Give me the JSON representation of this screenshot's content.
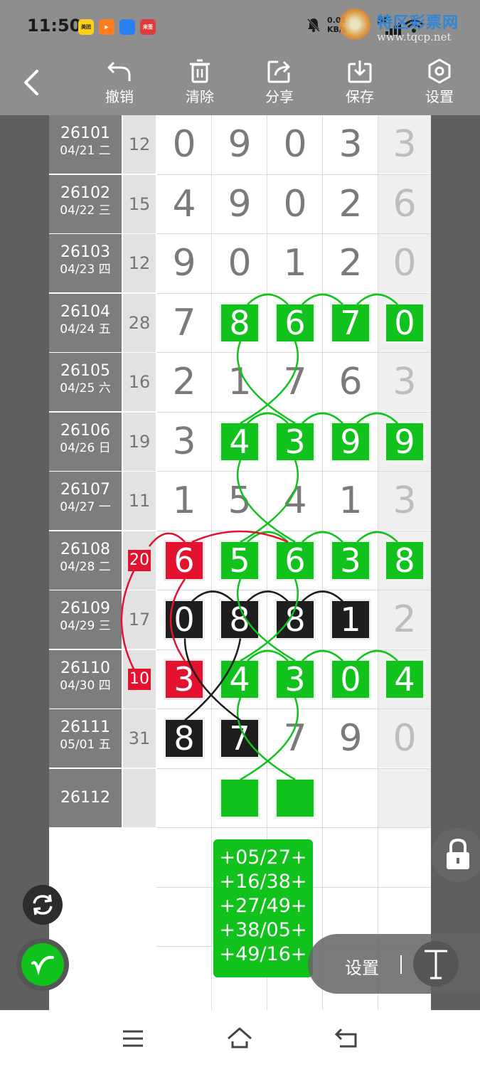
{
  "status_bar": {
    "time": "11:50",
    "app_icons": [
      {
        "label": "美团",
        "color": "#ffcf1a",
        "text_color": "#222222"
      },
      {
        "label": "▶",
        "color": "#ff7d22",
        "text_color": "#ffffff"
      },
      {
        "label": "",
        "color": "#2a80f0",
        "text_color": "#ffffff"
      },
      {
        "label": "来签",
        "color": "#e23b3b",
        "text_color": "#ffffff"
      }
    ],
    "net_speed_value": "0.01",
    "net_speed_unit": "KB/s",
    "signal_label": "5G",
    "watermark_title": "特区彩票网",
    "watermark_url": "www.tqcp.net"
  },
  "toolbar": {
    "undo": "撤销",
    "clear": "清除",
    "share": "分享",
    "save": "保存",
    "settings": "设置"
  },
  "rows": [
    {
      "issue": "26101",
      "date": "04/21 二",
      "sum": "12",
      "digits": [
        "0",
        "9",
        "0",
        "3",
        "3"
      ]
    },
    {
      "issue": "26102",
      "date": "04/22 三",
      "sum": "15",
      "digits": [
        "4",
        "9",
        "0",
        "2",
        "6"
      ]
    },
    {
      "issue": "26103",
      "date": "04/23 四",
      "sum": "12",
      "digits": [
        "9",
        "0",
        "1",
        "2",
        "0"
      ]
    },
    {
      "issue": "26104",
      "date": "04/24 五",
      "sum": "28",
      "digits": [
        "7",
        "8",
        "6",
        "7",
        "0"
      ]
    },
    {
      "issue": "26105",
      "date": "04/25 六",
      "sum": "16",
      "digits": [
        "2",
        "1",
        "7",
        "6",
        "3"
      ]
    },
    {
      "issue": "26106",
      "date": "04/26 日",
      "sum": "19",
      "digits": [
        "3",
        "4",
        "3",
        "9",
        "9"
      ]
    },
    {
      "issue": "26107",
      "date": "04/27 一",
      "sum": "11",
      "digits": [
        "1",
        "5",
        "4",
        "1",
        "3"
      ]
    },
    {
      "issue": "26108",
      "date": "04/28 二",
      "sum": "20",
      "digits": [
        "6",
        "5",
        "6",
        "3",
        "8"
      ]
    },
    {
      "issue": "26109",
      "date": "04/29 三",
      "sum": "17",
      "digits": [
        "0",
        "8",
        "8",
        "1",
        "2"
      ]
    },
    {
      "issue": "26110",
      "date": "04/30 四",
      "sum": "10",
      "digits": [
        "3",
        "4",
        "3",
        "0",
        "4"
      ]
    },
    {
      "issue": "26111",
      "date": "05/01 五",
      "sum": "31",
      "digits": [
        "8",
        "7",
        "7",
        "9",
        "0"
      ]
    },
    {
      "issue": "26112",
      "date": "",
      "sum": "",
      "digits": [
        "",
        "",
        "",
        "",
        ""
      ]
    }
  ],
  "highlights": {
    "green": [
      [
        3,
        1
      ],
      [
        3,
        2
      ],
      [
        3,
        3
      ],
      [
        3,
        4
      ],
      [
        5,
        1
      ],
      [
        5,
        2
      ],
      [
        5,
        3
      ],
      [
        5,
        4
      ],
      [
        7,
        1
      ],
      [
        7,
        2
      ],
      [
        7,
        3
      ],
      [
        7,
        4
      ],
      [
        9,
        1
      ],
      [
        9,
        2
      ],
      [
        9,
        3
      ],
      [
        9,
        4
      ],
      [
        11,
        1
      ],
      [
        11,
        2
      ]
    ],
    "black": [
      [
        8,
        0
      ],
      [
        8,
        1
      ],
      [
        8,
        2
      ],
      [
        8,
        3
      ],
      [
        10,
        0
      ],
      [
        10,
        1
      ]
    ],
    "red": [
      [
        7,
        0
      ],
      [
        9,
        0
      ]
    ],
    "red_sum_rows": [
      7,
      9
    ]
  },
  "colors": {
    "green": "#12c21c",
    "black": "#1e1e1e",
    "red": "#e3122e"
  },
  "prediction_lines": [
    "+05/27+",
    "+16/38+",
    "+27/49+",
    "+38/05+",
    "+49/16+"
  ],
  "float_panel": {
    "settings_label": "设置"
  },
  "icons": {
    "back": "chevron-left-icon",
    "undo": "undo-icon",
    "clear": "trash-icon",
    "share": "share-icon",
    "save": "download-icon",
    "settings": "gear-icon",
    "lock": "lock-icon",
    "refresh": "refresh-icon",
    "pen": "pen-icon",
    "text": "text-tool-icon",
    "nav_menu": "menu-icon",
    "nav_home": "home-icon",
    "nav_back": "back-icon"
  }
}
